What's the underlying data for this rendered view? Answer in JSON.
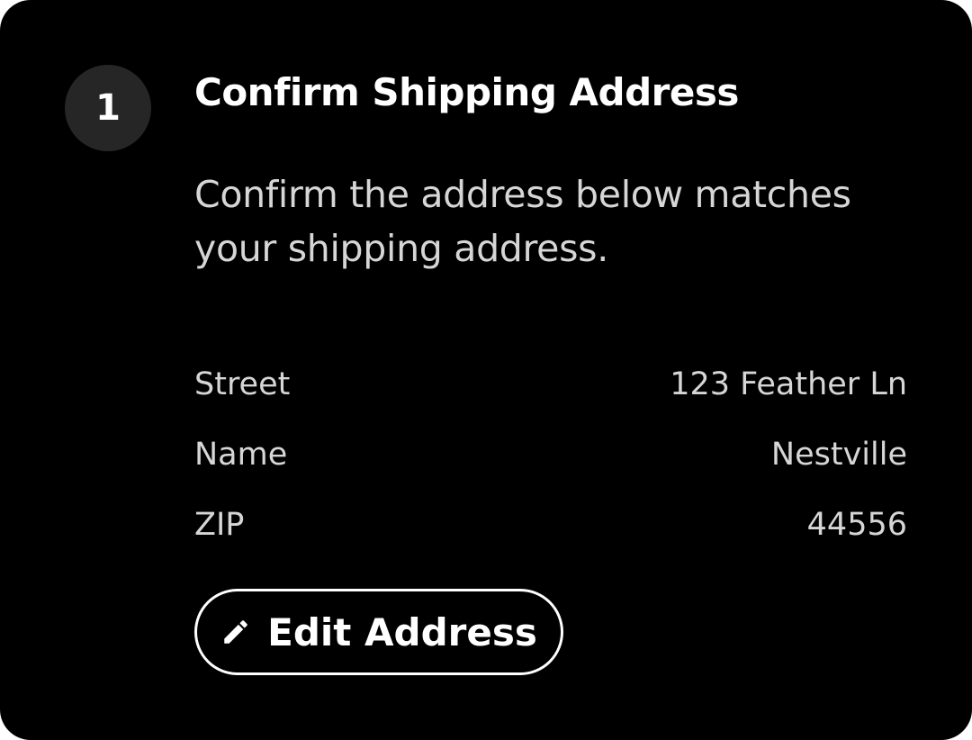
{
  "step": {
    "number": "1",
    "title": "Confirm Shipping Address",
    "description": "Confirm the address below matches your shipping address."
  },
  "address": {
    "rows": [
      {
        "label": "Street",
        "value": "123 Feather Ln"
      },
      {
        "label": "Name",
        "value": "Nestville"
      },
      {
        "label": "ZIP",
        "value": "44556"
      }
    ]
  },
  "actions": {
    "edit_label": "Edit Address",
    "edit_icon": "pencil-icon"
  },
  "colors": {
    "background": "#000000",
    "badge": "#262626",
    "text_primary": "#ffffff",
    "text_secondary": "#d6d6d6"
  }
}
